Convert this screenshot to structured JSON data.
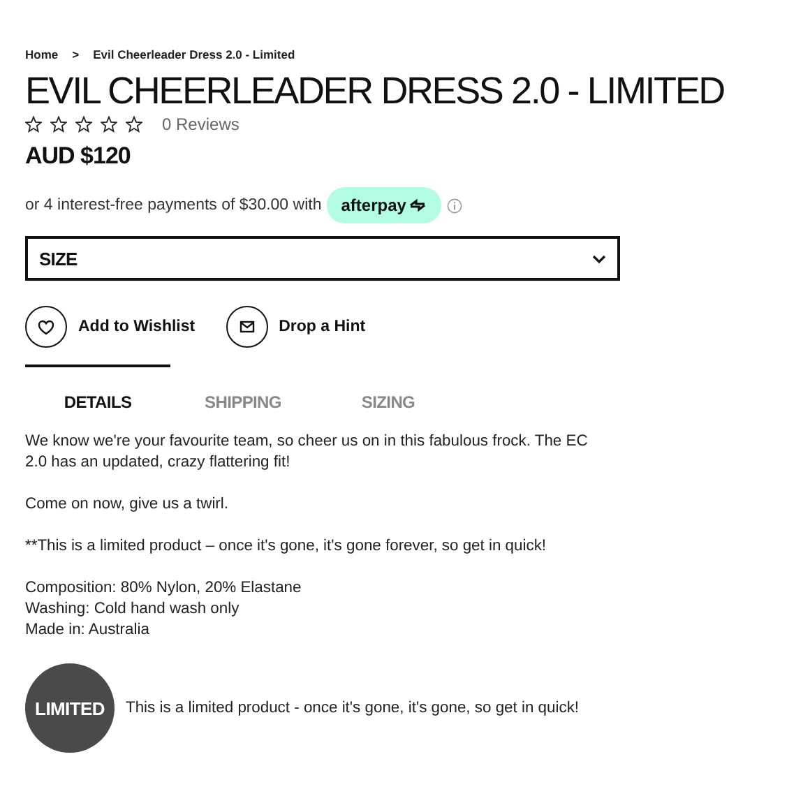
{
  "breadcrumb": [
    {
      "label": "Home"
    },
    {
      "label": ">"
    },
    {
      "label": "Evil Cheerleader Dress 2.0 - Limited"
    }
  ],
  "title": "EVIL CHEERLEADER DRESS 2.0 - LIMITED",
  "rating": {
    "stars": 0,
    "reviews": "0 Reviews"
  },
  "price": "AUD $120",
  "afterpay": {
    "text": "or 4 interest-free payments of $30.00 with",
    "badge": "afterpay"
  },
  "size_select": {
    "label": "SIZE"
  },
  "actions": [
    {
      "kind": "wishlist",
      "label": "Add to Wishlist"
    },
    {
      "kind": "hint",
      "label": "Drop a Hint"
    }
  ],
  "tabs": [
    {
      "label": "DETAILS",
      "selected": true
    },
    {
      "label": "SHIPPING",
      "selected": false
    },
    {
      "label": "SIZING",
      "selected": false
    }
  ],
  "description": [
    [
      "We know we're your favourite team, so cheer us on in this fabulous frock. The EC 2.0 has an updated, crazy flattering fit!"
    ],
    [
      "Come on now, give us a twirl."
    ],
    [
      "**This is a limited product – once it's gone, it's gone forever, so get in quick!"
    ],
    [
      "Composition: 80% Nylon, 20% Elastane",
      "Washing: Cold hand wash only",
      "Made in: Australia"
    ]
  ],
  "limited": {
    "badge": "LIMITED",
    "text": "This is a limited product - once it's gone, it's gone, so get in quick!"
  }
}
